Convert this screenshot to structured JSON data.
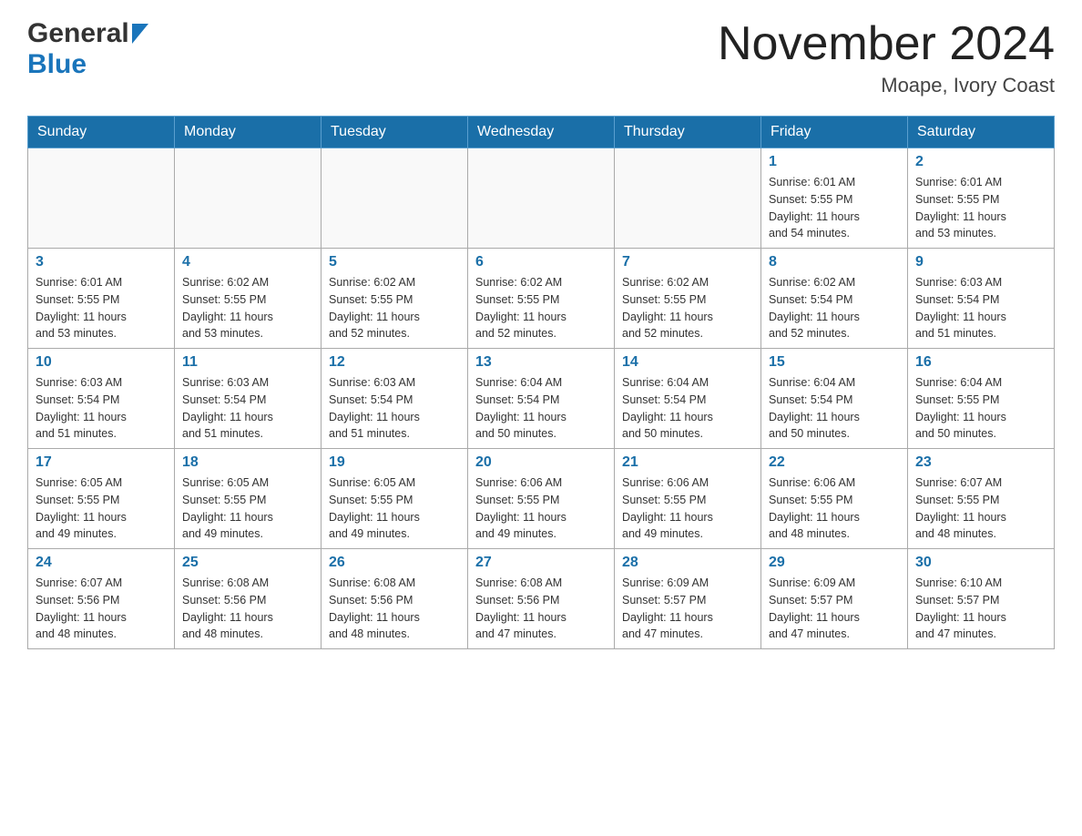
{
  "header": {
    "logo_general": "General",
    "logo_blue": "Blue",
    "month_title": "November 2024",
    "location": "Moape, Ivory Coast"
  },
  "weekdays": [
    "Sunday",
    "Monday",
    "Tuesday",
    "Wednesday",
    "Thursday",
    "Friday",
    "Saturday"
  ],
  "weeks": [
    [
      {
        "day": "",
        "info": ""
      },
      {
        "day": "",
        "info": ""
      },
      {
        "day": "",
        "info": ""
      },
      {
        "day": "",
        "info": ""
      },
      {
        "day": "",
        "info": ""
      },
      {
        "day": "1",
        "info": "Sunrise: 6:01 AM\nSunset: 5:55 PM\nDaylight: 11 hours\nand 54 minutes."
      },
      {
        "day": "2",
        "info": "Sunrise: 6:01 AM\nSunset: 5:55 PM\nDaylight: 11 hours\nand 53 minutes."
      }
    ],
    [
      {
        "day": "3",
        "info": "Sunrise: 6:01 AM\nSunset: 5:55 PM\nDaylight: 11 hours\nand 53 minutes."
      },
      {
        "day": "4",
        "info": "Sunrise: 6:02 AM\nSunset: 5:55 PM\nDaylight: 11 hours\nand 53 minutes."
      },
      {
        "day": "5",
        "info": "Sunrise: 6:02 AM\nSunset: 5:55 PM\nDaylight: 11 hours\nand 52 minutes."
      },
      {
        "day": "6",
        "info": "Sunrise: 6:02 AM\nSunset: 5:55 PM\nDaylight: 11 hours\nand 52 minutes."
      },
      {
        "day": "7",
        "info": "Sunrise: 6:02 AM\nSunset: 5:55 PM\nDaylight: 11 hours\nand 52 minutes."
      },
      {
        "day": "8",
        "info": "Sunrise: 6:02 AM\nSunset: 5:54 PM\nDaylight: 11 hours\nand 52 minutes."
      },
      {
        "day": "9",
        "info": "Sunrise: 6:03 AM\nSunset: 5:54 PM\nDaylight: 11 hours\nand 51 minutes."
      }
    ],
    [
      {
        "day": "10",
        "info": "Sunrise: 6:03 AM\nSunset: 5:54 PM\nDaylight: 11 hours\nand 51 minutes."
      },
      {
        "day": "11",
        "info": "Sunrise: 6:03 AM\nSunset: 5:54 PM\nDaylight: 11 hours\nand 51 minutes."
      },
      {
        "day": "12",
        "info": "Sunrise: 6:03 AM\nSunset: 5:54 PM\nDaylight: 11 hours\nand 51 minutes."
      },
      {
        "day": "13",
        "info": "Sunrise: 6:04 AM\nSunset: 5:54 PM\nDaylight: 11 hours\nand 50 minutes."
      },
      {
        "day": "14",
        "info": "Sunrise: 6:04 AM\nSunset: 5:54 PM\nDaylight: 11 hours\nand 50 minutes."
      },
      {
        "day": "15",
        "info": "Sunrise: 6:04 AM\nSunset: 5:54 PM\nDaylight: 11 hours\nand 50 minutes."
      },
      {
        "day": "16",
        "info": "Sunrise: 6:04 AM\nSunset: 5:55 PM\nDaylight: 11 hours\nand 50 minutes."
      }
    ],
    [
      {
        "day": "17",
        "info": "Sunrise: 6:05 AM\nSunset: 5:55 PM\nDaylight: 11 hours\nand 49 minutes."
      },
      {
        "day": "18",
        "info": "Sunrise: 6:05 AM\nSunset: 5:55 PM\nDaylight: 11 hours\nand 49 minutes."
      },
      {
        "day": "19",
        "info": "Sunrise: 6:05 AM\nSunset: 5:55 PM\nDaylight: 11 hours\nand 49 minutes."
      },
      {
        "day": "20",
        "info": "Sunrise: 6:06 AM\nSunset: 5:55 PM\nDaylight: 11 hours\nand 49 minutes."
      },
      {
        "day": "21",
        "info": "Sunrise: 6:06 AM\nSunset: 5:55 PM\nDaylight: 11 hours\nand 49 minutes."
      },
      {
        "day": "22",
        "info": "Sunrise: 6:06 AM\nSunset: 5:55 PM\nDaylight: 11 hours\nand 48 minutes."
      },
      {
        "day": "23",
        "info": "Sunrise: 6:07 AM\nSunset: 5:55 PM\nDaylight: 11 hours\nand 48 minutes."
      }
    ],
    [
      {
        "day": "24",
        "info": "Sunrise: 6:07 AM\nSunset: 5:56 PM\nDaylight: 11 hours\nand 48 minutes."
      },
      {
        "day": "25",
        "info": "Sunrise: 6:08 AM\nSunset: 5:56 PM\nDaylight: 11 hours\nand 48 minutes."
      },
      {
        "day": "26",
        "info": "Sunrise: 6:08 AM\nSunset: 5:56 PM\nDaylight: 11 hours\nand 48 minutes."
      },
      {
        "day": "27",
        "info": "Sunrise: 6:08 AM\nSunset: 5:56 PM\nDaylight: 11 hours\nand 47 minutes."
      },
      {
        "day": "28",
        "info": "Sunrise: 6:09 AM\nSunset: 5:57 PM\nDaylight: 11 hours\nand 47 minutes."
      },
      {
        "day": "29",
        "info": "Sunrise: 6:09 AM\nSunset: 5:57 PM\nDaylight: 11 hours\nand 47 minutes."
      },
      {
        "day": "30",
        "info": "Sunrise: 6:10 AM\nSunset: 5:57 PM\nDaylight: 11 hours\nand 47 minutes."
      }
    ]
  ]
}
